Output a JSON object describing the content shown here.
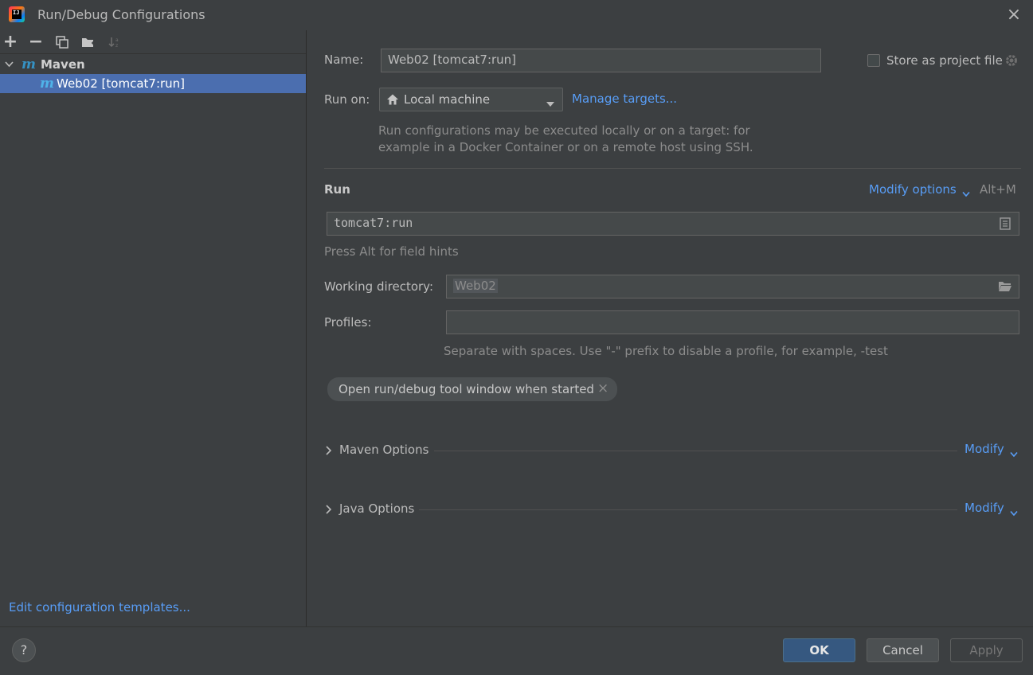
{
  "window": {
    "title": "Run/Debug Configurations"
  },
  "toolbar": {
    "add": "+",
    "remove": "−"
  },
  "tree": {
    "group_label": "Maven",
    "item_label": "Web02 [tomcat7:run]"
  },
  "left_footer": {
    "edit_templates": "Edit configuration templates..."
  },
  "form": {
    "name_label": "Name:",
    "name_value": "Web02 [tomcat7:run]",
    "store_label": "Store as project file",
    "run_on_label": "Run on:",
    "run_on_value": "Local machine",
    "manage_targets": "Manage targets...",
    "run_on_hint_1": "Run configurations may be executed locally or on a target: for",
    "run_on_hint_2": "example in a Docker Container or on a remote host using SSH.",
    "run_section": "Run",
    "modify_options": "Modify options",
    "modify_shortcut": "Alt+M",
    "command_value": "tomcat7:run",
    "field_hint": "Press Alt for field hints",
    "working_dir_label": "Working directory:",
    "working_dir_value": "Web02",
    "profiles_label": "Profiles:",
    "profiles_value": "",
    "profiles_hint": "Separate with spaces. Use \"-\" prefix to disable a profile, for example, -test",
    "chip_label": "Open run/debug tool window when started",
    "maven_options": "Maven Options",
    "java_options": "Java Options",
    "modify": "Modify"
  },
  "buttons": {
    "help": "?",
    "ok": "OK",
    "cancel": "Cancel",
    "apply": "Apply"
  },
  "colors": {
    "accent": "#589df6",
    "selection": "#4b6eaf",
    "ok_button": "#365880"
  }
}
